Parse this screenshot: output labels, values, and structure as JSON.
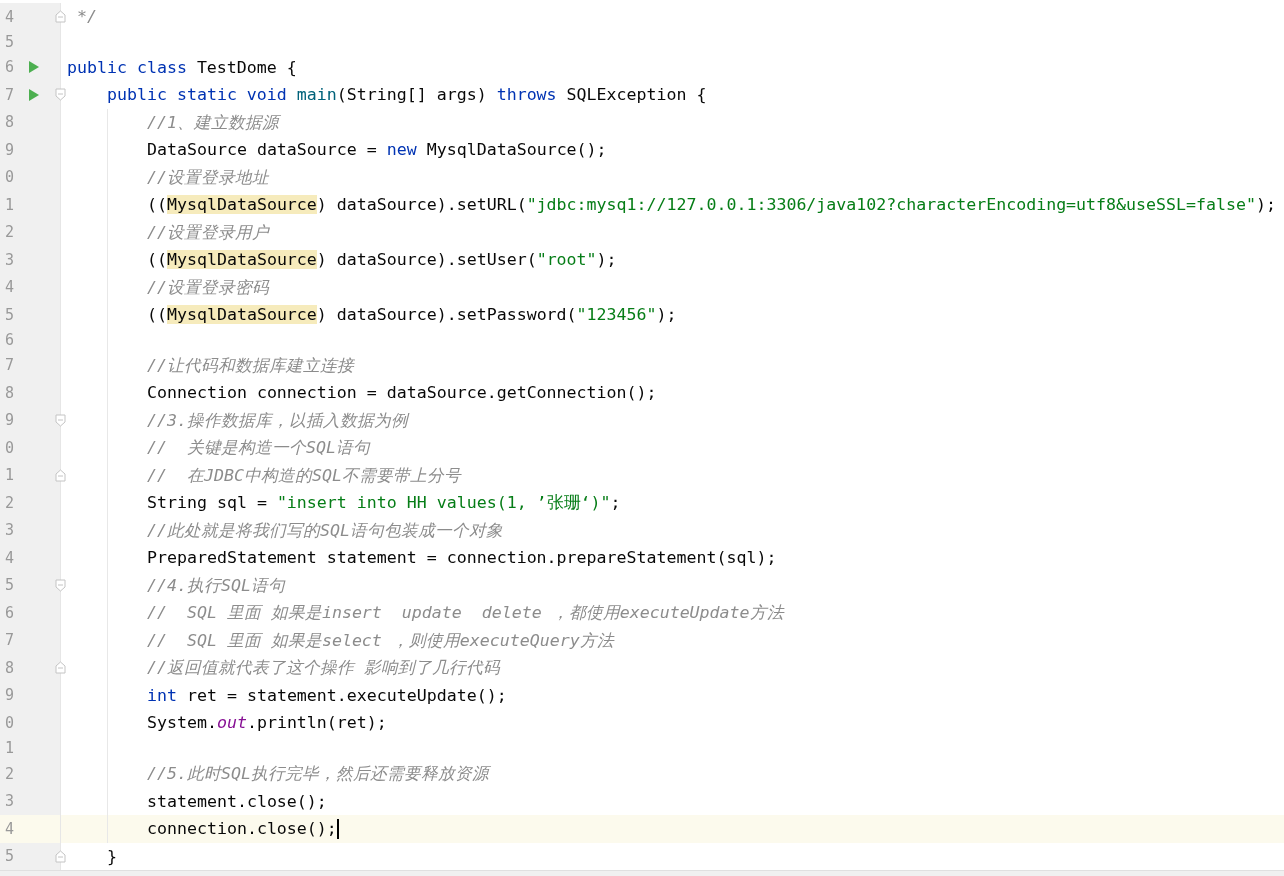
{
  "editor": {
    "lines": [
      {
        "number": "4",
        "run": false,
        "current": false,
        "fold_start": false,
        "fold_end": true,
        "tokens": [
          {
            "kind": "comment",
            "text": " */"
          }
        ]
      },
      {
        "number": "5",
        "run": false,
        "current": false,
        "fold_start": false,
        "fold_end": false
      },
      {
        "number": "6",
        "run": true,
        "current": false,
        "fold_start": false,
        "fold_end": false,
        "tokens": [
          {
            "kind": "keyword",
            "text": "public class"
          },
          {
            "kind": "plain",
            "text": " TestDome {"
          }
        ],
        "children": [
          {
            "number": "7",
            "run": true,
            "current": false,
            "fold_start": true,
            "fold_end": false,
            "tokens": [
              {
                "kind": "keyword",
                "text": "public static void "
              },
              {
                "kind": "method",
                "text": "main"
              },
              {
                "kind": "plain",
                "text": "(String[] args) "
              },
              {
                "kind": "keyword",
                "text": "throws"
              },
              {
                "kind": "plain",
                "text": " SQLException {"
              }
            ],
            "children": [
              {
                "number": "8",
                "run": false,
                "current": false,
                "fold_start": false,
                "fold_end": false,
                "tokens": [
                  {
                    "kind": "comment",
                    "text": "//1、建立数据源"
                  }
                ]
              },
              {
                "number": "9",
                "run": false,
                "current": false,
                "fold_start": false,
                "fold_end": false,
                "tokens": [
                  {
                    "kind": "plain",
                    "text": "DataSource dataSource = "
                  },
                  {
                    "kind": "keyword",
                    "text": "new"
                  },
                  {
                    "kind": "plain",
                    "text": " MysqlDataSource();"
                  }
                ]
              },
              {
                "number": "0",
                "run": false,
                "current": false,
                "fold_start": false,
                "fold_end": false,
                "tokens": [
                  {
                    "kind": "comment",
                    "text": "//设置登录地址"
                  }
                ]
              },
              {
                "number": "1",
                "run": false,
                "current": false,
                "fold_start": false,
                "fold_end": false,
                "tokens": [
                  {
                    "kind": "plain",
                    "text": "(("
                  },
                  {
                    "kind": "highlight",
                    "text": "MysqlDataSource"
                  },
                  {
                    "kind": "plain",
                    "text": ") dataSource).setURL("
                  },
                  {
                    "kind": "string",
                    "text": "\"jdbc:mysq1://127.0.0.1:3306/java102?characterEncoding=utf8&useSSL=false\""
                  },
                  {
                    "kind": "plain",
                    "text": ");"
                  }
                ]
              },
              {
                "number": "2",
                "run": false,
                "current": false,
                "fold_start": false,
                "fold_end": false,
                "tokens": [
                  {
                    "kind": "comment",
                    "text": "//设置登录用户"
                  }
                ]
              },
              {
                "number": "3",
                "run": false,
                "current": false,
                "fold_start": false,
                "fold_end": false,
                "tokens": [
                  {
                    "kind": "plain",
                    "text": "(("
                  },
                  {
                    "kind": "highlight",
                    "text": "MysqlDataSource"
                  },
                  {
                    "kind": "plain",
                    "text": ") dataSource).setUser("
                  },
                  {
                    "kind": "string",
                    "text": "\"root\""
                  },
                  {
                    "kind": "plain",
                    "text": ");"
                  }
                ]
              },
              {
                "number": "4",
                "run": false,
                "current": false,
                "fold_start": false,
                "fold_end": false,
                "tokens": [
                  {
                    "kind": "comment",
                    "text": "//设置登录密码"
                  }
                ]
              },
              {
                "number": "5",
                "run": false,
                "current": false,
                "fold_start": false,
                "fold_end": false,
                "tokens": [
                  {
                    "kind": "plain",
                    "text": "(("
                  },
                  {
                    "kind": "highlight",
                    "text": "MysqlDataSource"
                  },
                  {
                    "kind": "plain",
                    "text": ") dataSource).setPassword("
                  },
                  {
                    "kind": "string",
                    "text": "\"123456\""
                  },
                  {
                    "kind": "plain",
                    "text": ");"
                  }
                ]
              },
              {
                "number": "6",
                "run": false,
                "current": false,
                "fold_start": false,
                "fold_end": false
              },
              {
                "number": "7",
                "run": false,
                "current": false,
                "fold_start": false,
                "fold_end": false,
                "tokens": [
                  {
                    "kind": "comment",
                    "text": "//让代码和数据库建立连接"
                  }
                ]
              },
              {
                "number": "8",
                "run": false,
                "current": false,
                "fold_start": false,
                "fold_end": false,
                "tokens": [
                  {
                    "kind": "plain",
                    "text": "Connection connection = dataSource.getConnection();"
                  }
                ]
              },
              {
                "number": "9",
                "run": false,
                "current": false,
                "fold_start": true,
                "fold_end": false,
                "tokens": [
                  {
                    "kind": "comment",
                    "text": "//3.操作数据库，以插入数据为例"
                  }
                ]
              },
              {
                "number": "0",
                "run": false,
                "current": false,
                "fold_start": false,
                "fold_end": false,
                "tokens": [
                  {
                    "kind": "comment",
                    "text": "//  关键是构造一个SQL语句"
                  }
                ]
              },
              {
                "number": "1",
                "run": false,
                "current": false,
                "fold_start": false,
                "fold_end": true,
                "tokens": [
                  {
                    "kind": "comment",
                    "text": "//  在JDBC中构造的SQL不需要带上分号"
                  }
                ]
              },
              {
                "number": "2",
                "run": false,
                "current": false,
                "fold_start": false,
                "fold_end": false,
                "tokens": [
                  {
                    "kind": "plain",
                    "text": "String sql = "
                  },
                  {
                    "kind": "string",
                    "text": "\"insert into HH values(1, ’张珊‘)\""
                  },
                  {
                    "kind": "plain",
                    "text": ";"
                  }
                ]
              },
              {
                "number": "3",
                "run": false,
                "current": false,
                "fold_start": false,
                "fold_end": false,
                "tokens": [
                  {
                    "kind": "comment",
                    "text": "//此处就是将我们写的SQL语句包装成一个对象"
                  }
                ]
              },
              {
                "number": "4",
                "run": false,
                "current": false,
                "fold_start": false,
                "fold_end": false,
                "tokens": [
                  {
                    "kind": "plain",
                    "text": "PreparedStatement statement = connection.prepareStatement(sql);"
                  }
                ]
              },
              {
                "number": "5",
                "run": false,
                "current": false,
                "fold_start": true,
                "fold_end": false,
                "tokens": [
                  {
                    "kind": "comment",
                    "text": "//4.执行SQL语句"
                  }
                ]
              },
              {
                "number": "6",
                "run": false,
                "current": false,
                "fold_start": false,
                "fold_end": false,
                "tokens": [
                  {
                    "kind": "comment",
                    "text": "//  SQL 里面 如果是insert  update  delete ，都使用executeUpdate方法"
                  }
                ]
              },
              {
                "number": "7",
                "run": false,
                "current": false,
                "fold_start": false,
                "fold_end": false,
                "tokens": [
                  {
                    "kind": "comment",
                    "text": "//  SQL 里面 如果是select ，则使用executeQuery方法"
                  }
                ]
              },
              {
                "number": "8",
                "run": false,
                "current": false,
                "fold_start": false,
                "fold_end": true,
                "tokens": [
                  {
                    "kind": "comment",
                    "text": "//返回值就代表了这个操作 影响到了几行代码"
                  }
                ]
              },
              {
                "number": "9",
                "run": false,
                "current": false,
                "fold_start": false,
                "fold_end": false,
                "tokens": [
                  {
                    "kind": "keyword",
                    "text": "int"
                  },
                  {
                    "kind": "plain",
                    "text": " ret = statement.executeUpdate();"
                  }
                ]
              },
              {
                "number": "0",
                "run": false,
                "current": false,
                "fold_start": false,
                "fold_end": false,
                "tokens": [
                  {
                    "kind": "plain",
                    "text": "System."
                  },
                  {
                    "kind": "field",
                    "text": "out"
                  },
                  {
                    "kind": "plain",
                    "text": ".println(ret);"
                  }
                ]
              },
              {
                "number": "1",
                "run": false,
                "current": false,
                "fold_start": false,
                "fold_end": false
              },
              {
                "number": "2",
                "run": false,
                "current": false,
                "fold_start": false,
                "fold_end": false,
                "tokens": [
                  {
                    "kind": "comment",
                    "text": "//5.此时SQL执行完毕，然后还需要释放资源"
                  }
                ]
              },
              {
                "number": "3",
                "run": false,
                "current": false,
                "fold_start": false,
                "fold_end": false,
                "tokens": [
                  {
                    "kind": "plain",
                    "text": "statement.close();"
                  }
                ]
              },
              {
                "number": "4",
                "run": false,
                "current": true,
                "fold_start": false,
                "fold_end": false,
                "tokens": [
                  {
                    "kind": "plain",
                    "text": "connection.close();"
                  }
                ]
              }
            ]
          },
          {
            "number": "5",
            "run": false,
            "current": false,
            "fold_start": false,
            "fold_end": true,
            "tokens": [
              {
                "kind": "plain",
                "text": "}"
              }
            ]
          }
        ]
      }
    ]
  }
}
